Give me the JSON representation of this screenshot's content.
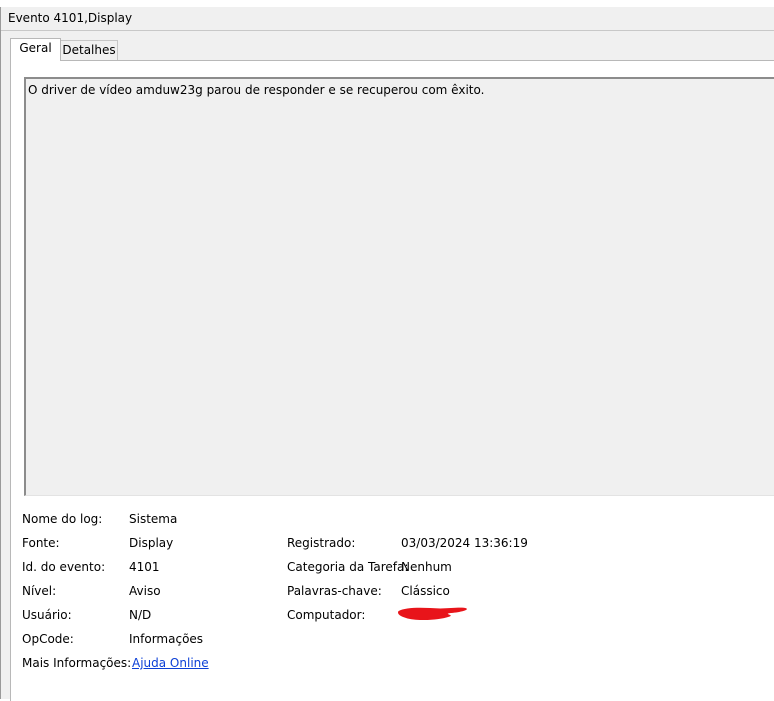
{
  "window": {
    "title": "Evento 4101,Display"
  },
  "tabs": [
    {
      "label": "Geral",
      "active": true
    },
    {
      "label": "Detalhes",
      "active": false
    }
  ],
  "description": "O driver de vídeo amduw23g parou de responder e se recuperou com êxito.",
  "details": {
    "log_name_label": "Nome do log:",
    "log_name_value": "Sistema",
    "source_label": "Fonte:",
    "source_value": "Display",
    "event_id_label": "Id. do evento:",
    "event_id_value": "4101",
    "level_label": "Nível:",
    "level_value": "Aviso",
    "user_label": "Usuário:",
    "user_value": "N/D",
    "opcode_label": "OpCode:",
    "opcode_value": "Informações",
    "more_info_label": "Mais Informações:",
    "more_info_link": "Ajuda Online",
    "logged_label": "Registrado:",
    "logged_value": "03/03/2024 13:36:19",
    "task_category_label": "Categoria da Tarefa:",
    "task_category_value": "Nenhum",
    "keywords_label": "Palavras-chave:",
    "keywords_value": "Clássico",
    "computer_label": "Computador:"
  },
  "colors": {
    "window_bg": "#f0f0f0",
    "panel_bg": "#ffffff",
    "link": "#0b3fd6",
    "redaction": "#e8141a"
  }
}
